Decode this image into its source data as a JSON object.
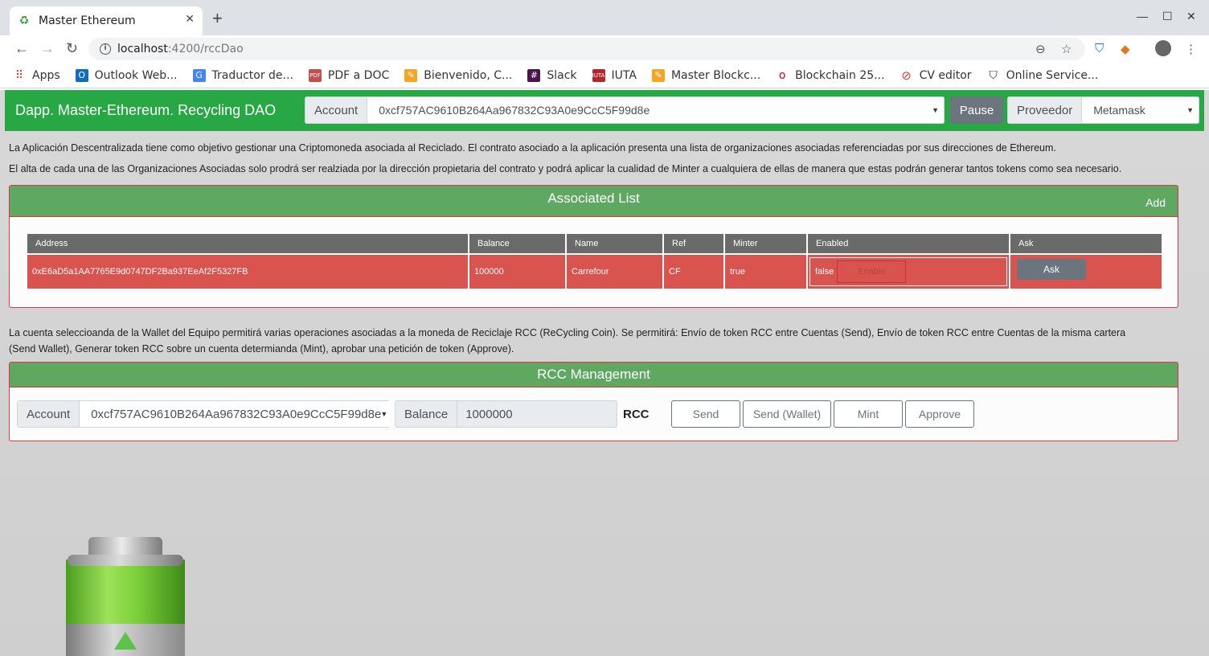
{
  "browser": {
    "tab_title": "Master Ethereum",
    "url_host": "localhost",
    "url_path": ":4200/rccDao",
    "bookmarks": [
      {
        "label": "Apps",
        "icon": "apps-grid-icon"
      },
      {
        "label": "Outlook Web...",
        "icon": "outlook-icon"
      },
      {
        "label": "Traductor de...",
        "icon": "translate-icon"
      },
      {
        "label": "PDF a DOC",
        "icon": "pdf-icon"
      },
      {
        "label": "Bienvenido, C...",
        "icon": "pencil-icon"
      },
      {
        "label": "Slack",
        "icon": "slack-icon"
      },
      {
        "label": "IUTA",
        "icon": "iuta-icon"
      },
      {
        "label": "Master Blockc...",
        "icon": "pencil-icon"
      },
      {
        "label": "Blockchain 25...",
        "icon": "blockchain-icon"
      },
      {
        "label": "CV editor",
        "icon": "cv-icon"
      },
      {
        "label": "Online Service...",
        "icon": "shield-icon"
      }
    ]
  },
  "navbar": {
    "brand": "Dapp. Master-Ethereum. Recycling DAO",
    "account_label": "Account",
    "account_value": "0xcf757AC9610B264Aa967832C93A0e9CcC5F99d8e",
    "pause_label": "Pause",
    "provider_label": "Proveedor",
    "provider_value": "Metamask"
  },
  "intro": {
    "line1": "La Aplicación Descentralizada tiene como objetivo gestionar una Criptomoneda asociada al Reciclado. El contrato asociado a la aplicación presenta una lista de organizaciones asociadas referenciadas por sus direcciones de Ethereum.",
    "line2": "El alta de cada una de las Organizaciones Asociadas solo prodrá ser realziada por la dirección propietaria del contrato y podrá aplicar la cualidad de Minter a cualquiera de ellas de manera que estas podrán generar tantos tokens como sea necesario."
  },
  "associated": {
    "title": "Associated List",
    "add_label": "Add",
    "columns": [
      "Address",
      "Balance",
      "Name",
      "Ref",
      "Minter",
      "Enabled",
      "Ask"
    ],
    "rows": [
      {
        "address": "0xE6aD5a1AA7765E9d0747DF2Ba937EeAf2F5327FB",
        "balance": "100000",
        "name": "Carrefour",
        "ref": "CF",
        "minter": "true",
        "enabled": "false",
        "enable_label": "Enable",
        "ask_label": "Ask"
      }
    ]
  },
  "wallet_desc": {
    "line1": "La cuenta seleccioanda de la Wallet del Equipo permitirá varias operaciones asociadas a la moneda de Reciclaje RCC (ReCycling Coin). Se permitirá: Envío de token RCC entre Cuentas (Send), Envío de token RCC entre Cuentas de la misma cartera",
    "line2": "(Send Wallet), Generar token RCC sobre un cuenta determianda (Mint), aprobar una petición de token (Approve)."
  },
  "rcc": {
    "title": "RCC Management",
    "account_label": "Account",
    "account_value": "0xcf757AC9610B264Aa967832C93A0e9CcC5F99d8e",
    "balance_label": "Balance",
    "balance_value": "1000000",
    "unit": "RCC",
    "send_label": "Send",
    "send_wallet_label": "Send (Wallet)",
    "mint_label": "Mint",
    "approve_label": "Approve"
  }
}
